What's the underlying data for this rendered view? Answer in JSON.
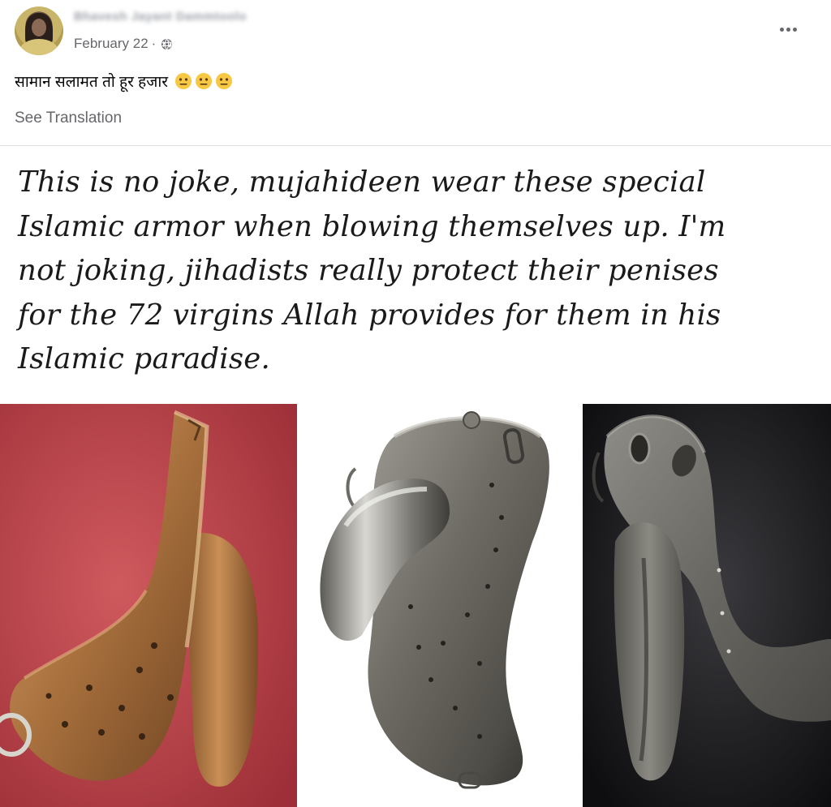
{
  "post": {
    "author_name": "Bhavesh Jayant Dammtoolo",
    "date": "February 22",
    "separator": "·",
    "privacy_icon": "globe-icon",
    "more_icon": "more-options-icon",
    "caption": "सामान सलामत तो हूर हजार",
    "caption_emojis": [
      "neutral-face-emoji",
      "neutral-face-emoji",
      "neutral-face-emoji"
    ],
    "see_translation": "See Translation"
  },
  "meme": {
    "text_lines": [
      "This is no joke, mujahideen wear these special",
      "Islamic armor when blowing themselves up. I'm",
      "not joking, jihadists really protect their penises",
      "for the 72 virgins  Allah provides for them in his",
      "Islamic paradise."
    ],
    "photos": [
      "bronze-artifact-photo",
      "silver-artifact-photo",
      "dark-artifact-photo"
    ]
  },
  "colors": {
    "secondary_text": "#65676b",
    "divider": "#dadde1",
    "photo1_bg": "#c0424a",
    "photo3_bg": "#1c1c1e"
  }
}
